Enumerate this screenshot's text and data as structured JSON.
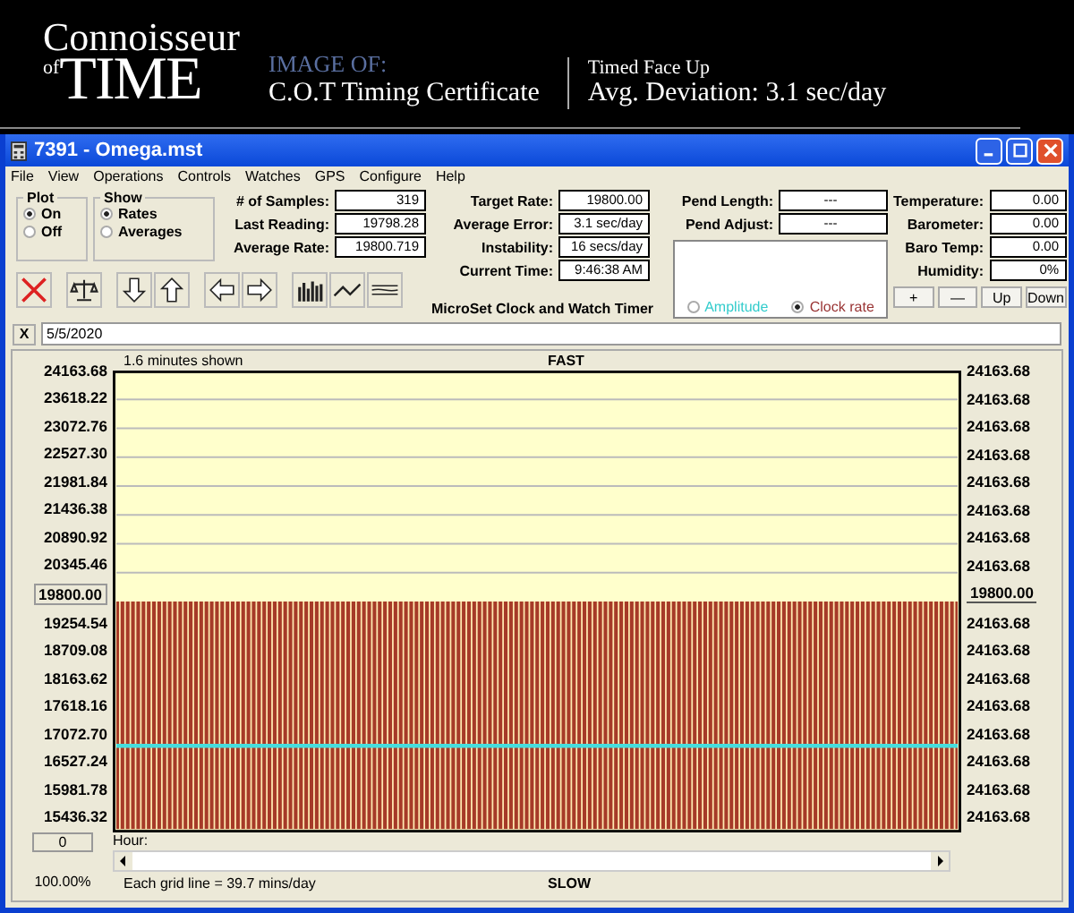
{
  "banner": {
    "logo_top": "Connoisseur",
    "logo_of": "of",
    "logo_main": "TIME",
    "image_of": "IMAGE OF:",
    "certificate": "C.O.T Timing Certificate",
    "position": "Timed Face Up",
    "deviation": "Avg. Deviation: 3.1 sec/day"
  },
  "window": {
    "title": "7391 - Omega.mst"
  },
  "menu": [
    "File",
    "View",
    "Operations",
    "Controls",
    "Watches",
    "GPS",
    "Configure",
    "Help"
  ],
  "plot_group": {
    "title": "Plot",
    "options": [
      {
        "label": "On",
        "selected": true
      },
      {
        "label": "Off",
        "selected": false
      }
    ]
  },
  "show_group": {
    "title": "Show",
    "options": [
      {
        "label": "Rates",
        "selected": true
      },
      {
        "label": "Averages",
        "selected": false
      }
    ]
  },
  "stats_left": [
    {
      "label": "# of Samples:",
      "value": "319"
    },
    {
      "label": "Last Reading:",
      "value": "19798.28"
    },
    {
      "label": "Average Rate:",
      "value": "19800.719"
    }
  ],
  "stats_right": [
    {
      "label": "Target Rate:",
      "value": "19800.00"
    },
    {
      "label": "Average Error:",
      "value": "3.1 sec/day"
    },
    {
      "label": "Instability:",
      "value": "16 secs/day"
    },
    {
      "label": "Current Time:",
      "value": "9:46:38 AM"
    }
  ],
  "app_name": "MicroSet Clock and Watch Timer",
  "pend": [
    {
      "label": "Pend Length:",
      "value": "---"
    },
    {
      "label": "Pend Adjust:",
      "value": "---"
    }
  ],
  "mode_options": [
    {
      "label": "Amplitude",
      "selected": false,
      "color": "#33cccc"
    },
    {
      "label": "Clock rate",
      "selected": true,
      "color": "#993333"
    }
  ],
  "environment": [
    {
      "label": "Temperature:",
      "value": "0.00"
    },
    {
      "label": "Barometer:",
      "value": "0.00"
    },
    {
      "label": "Baro Temp:",
      "value": "0.00"
    },
    {
      "label": "Humidity:",
      "value": "0%"
    }
  ],
  "step_buttons": [
    "+",
    "—",
    "Up",
    "Down"
  ],
  "date_bar": {
    "close": "X",
    "value": "5/5/2020"
  },
  "chart": {
    "shown_label": "1.6 minutes shown",
    "top_label": "FAST",
    "bottom_label": "SLOW",
    "left_axis": [
      "24163.68",
      "23618.22",
      "23072.76",
      "22527.30",
      "21981.84",
      "21436.38",
      "20890.92",
      "20345.46",
      "19800.00",
      "19254.54",
      "18709.08",
      "18163.62",
      "17618.16",
      "17072.70",
      "16527.24",
      "15981.78",
      "15436.32"
    ],
    "right_axis": [
      "24163.68",
      "24163.68",
      "24163.68",
      "24163.68",
      "24163.68",
      "24163.68",
      "24163.68",
      "24163.68",
      "19800.00",
      "24163.68",
      "24163.68",
      "24163.68",
      "24163.68",
      "24163.68",
      "24163.68",
      "24163.68",
      "24163.68"
    ],
    "hour_label": "Hour:",
    "hour_button": "0",
    "zoom": "100.00%",
    "grid_note": "Each grid line = 39.7 mins/day"
  }
}
